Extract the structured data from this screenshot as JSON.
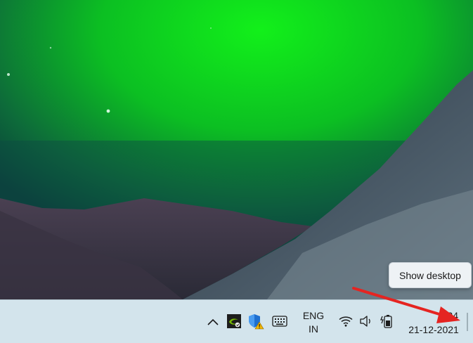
{
  "tooltip": {
    "text": "Show desktop"
  },
  "tray": {
    "language": {
      "line1": "ENG",
      "line2": "IN"
    },
    "clock": {
      "time": "24",
      "date": "21-12-2021"
    },
    "icons": [
      "chevron-up-icon",
      "nvidia-icon",
      "windows-security-icon",
      "keyboard-icon",
      "wifi-icon",
      "volume-icon",
      "battery-charging-icon"
    ]
  },
  "colors": {
    "taskbar": "#d3e4ec",
    "aurora": "#12e81a",
    "annotation_arrow": "#e52421"
  }
}
